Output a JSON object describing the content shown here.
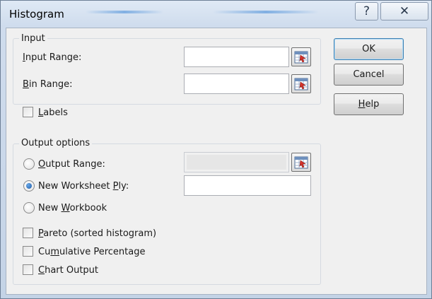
{
  "window": {
    "title": "Histogram",
    "help_glyph": "?",
    "close_glyph": "✕"
  },
  "input": {
    "legend": "Input",
    "input_range": {
      "label_accel": "I",
      "label_rest": "nput Range:",
      "value": ""
    },
    "bin_range": {
      "label_accel": "B",
      "label_rest": "in Range:",
      "value": ""
    },
    "labels": {
      "label_accel": "L",
      "label_rest": "abels",
      "checked": false
    }
  },
  "output": {
    "legend": "Output options",
    "output_range": {
      "label_accel": "O",
      "label_rest": "utput Range:",
      "selected": false,
      "value": ""
    },
    "new_worksheet_ply": {
      "label_pre": "New Worksheet ",
      "label_accel": "P",
      "label_rest": "ly:",
      "selected": true,
      "value": ""
    },
    "new_workbook": {
      "label_pre": "New ",
      "label_accel": "W",
      "label_rest": "orkbook",
      "selected": false
    },
    "pareto": {
      "label_accel": "P",
      "label_rest": "areto (sorted histogram)",
      "checked": false
    },
    "cumulative": {
      "label_pre": "Cu",
      "label_accel": "m",
      "label_rest": "ulative Percentage",
      "checked": false
    },
    "chart_output": {
      "label_accel": "C",
      "label_rest": "hart Output",
      "checked": false
    }
  },
  "buttons": {
    "ok": "OK",
    "cancel": "Cancel",
    "help_accel": "H",
    "help_rest": "elp"
  },
  "icons": {
    "help": "question-mark-icon",
    "close": "close-x-icon",
    "range_selector": "collapse-dialog-icon"
  },
  "colors": {
    "accent": "#3c7fb1",
    "radio_fill": "#1c5aa8",
    "ref_icon_red": "#d8322a"
  }
}
